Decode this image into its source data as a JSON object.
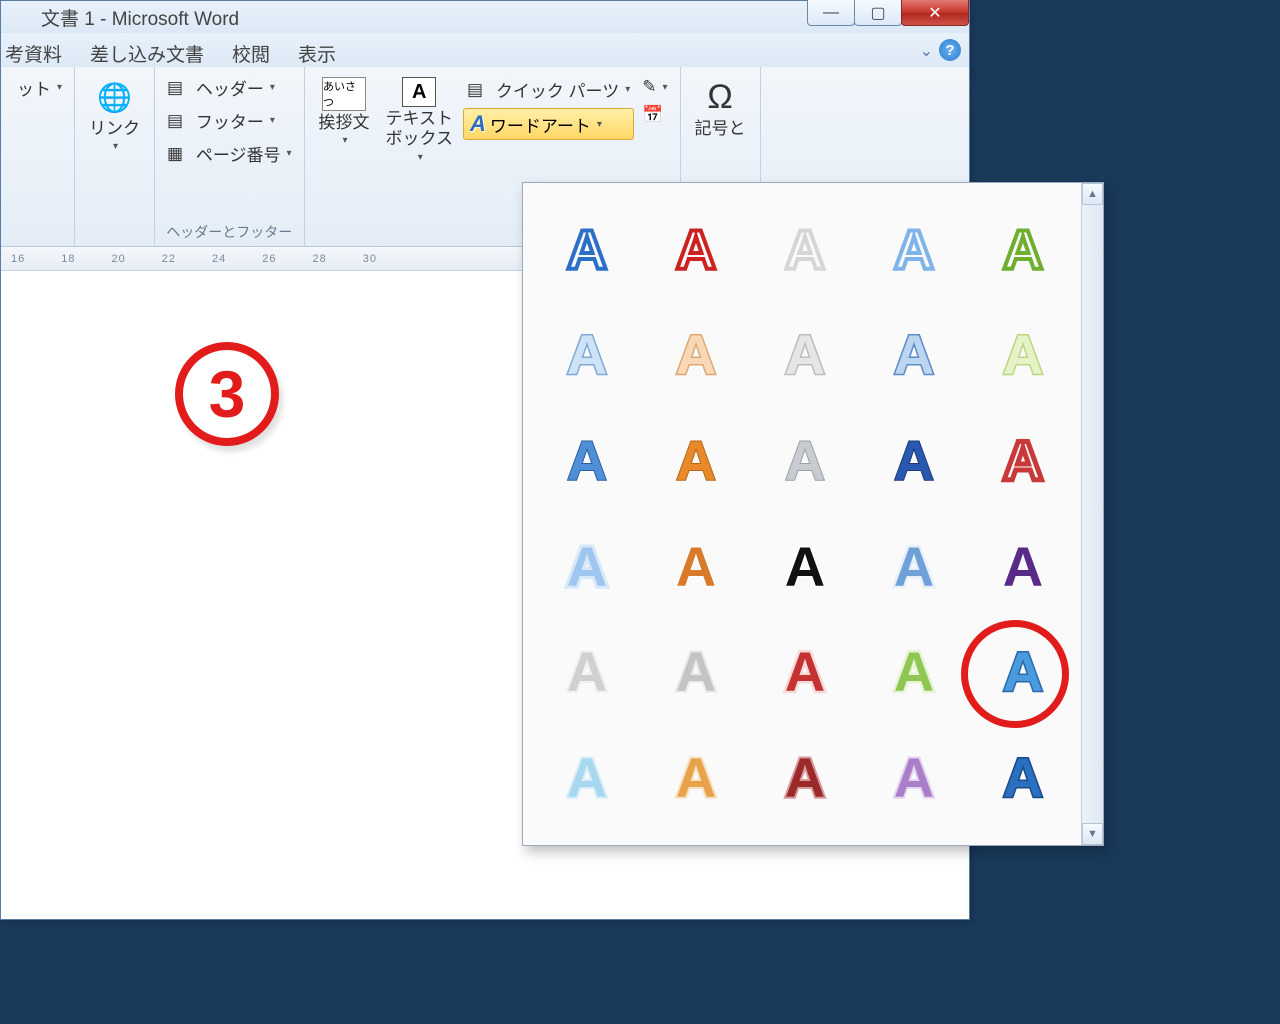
{
  "titlebar": {
    "title": "文書 1 - Microsoft Word"
  },
  "tabs": {
    "t0": "考資料",
    "t1": "差し込み文書",
    "t2": "校閲",
    "t3": "表示"
  },
  "ribbon": {
    "cut_dd": "ット",
    "link": "リンク",
    "header": "ヘッダー",
    "footer": "フッター",
    "page_number": "ページ番号",
    "hf_group": "ヘッダーとフッター",
    "greeting": "挨拶文",
    "greeting_ico": "あいさつ",
    "textbox": "テキスト\nボックス",
    "quickparts": "クイック パーツ",
    "wordart": "ワードアート",
    "symbol_omega": "Ω",
    "symbol_label": "記号と"
  },
  "ruler": [
    "16",
    "18",
    "20",
    "22",
    "24",
    "26",
    "28",
    "30"
  ],
  "annotation": {
    "number": "3"
  },
  "gallery": {
    "rows": 6,
    "cols": 5,
    "highlight_row": 4,
    "highlight_col": 4,
    "styles": [
      [
        "blue-outline",
        "red-outline",
        "white-outline",
        "lightblue-outline",
        "green-outline"
      ],
      [
        "blue-bevel-light",
        "orange-bevel-light",
        "gray-bevel-light",
        "blue-bevel",
        "lime-bevel-light"
      ],
      [
        "blue-shiny",
        "orange-shiny",
        "silver-shiny",
        "navy-shiny",
        "red-hatched"
      ],
      [
        "lightblue-glow",
        "orange-glow",
        "black-fill",
        "softblue-glow",
        "purple-fill"
      ],
      [
        "gray-soft",
        "gray-soft2",
        "red-glow",
        "green-glow",
        "blue-3d"
      ],
      [
        "cyan-reflect",
        "orange-reflect",
        "darkred-reflect",
        "violet-reflect",
        "blue-deep"
      ]
    ]
  }
}
